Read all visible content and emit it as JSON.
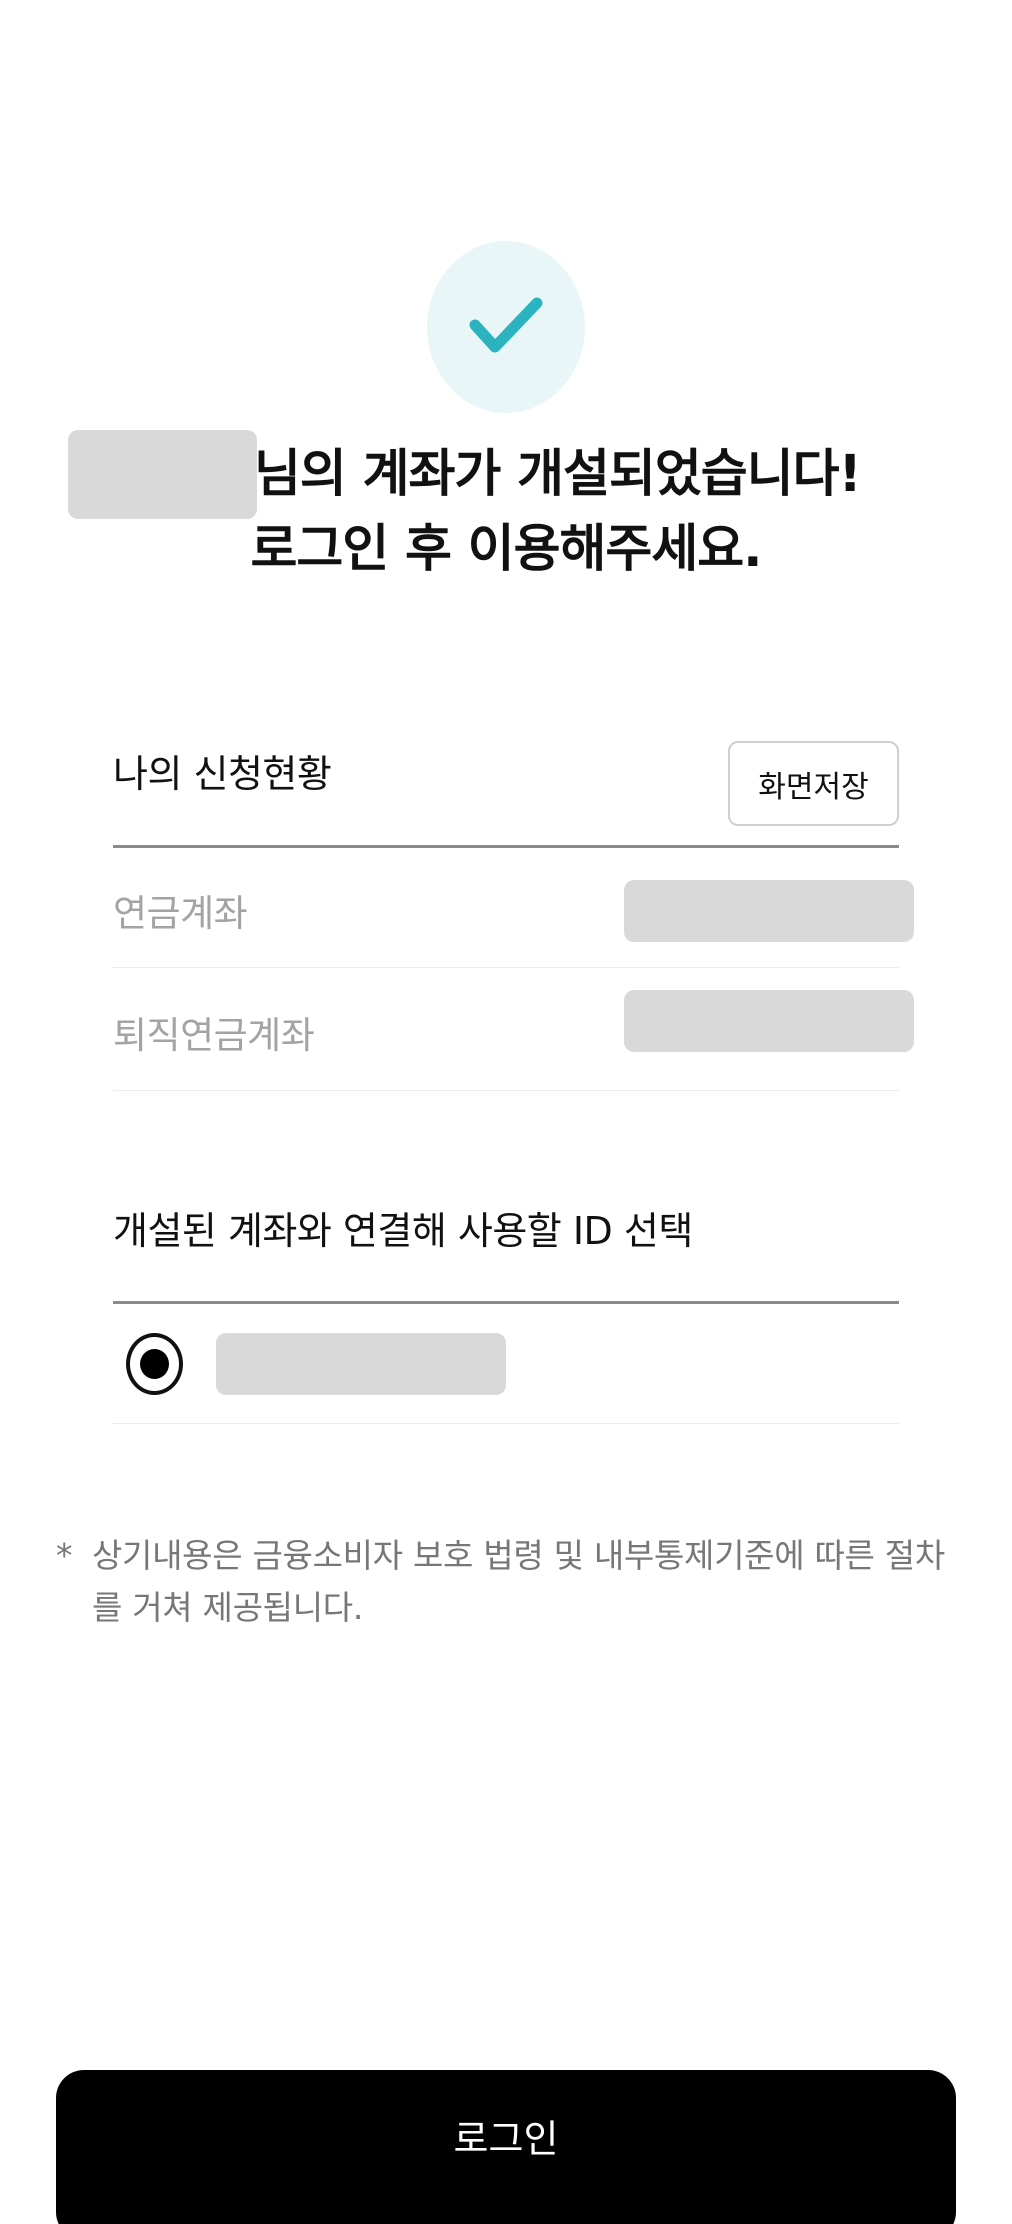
{
  "header": {
    "headline_line1": "님의 계좌가 개설되었습니다!",
    "headline_line2": "로그인 후 이용해주세요."
  },
  "application_status": {
    "title": "나의 신청현황",
    "save_label": "화면저장",
    "rows": [
      {
        "label": "연금계좌"
      },
      {
        "label": "퇴직연금계좌"
      }
    ]
  },
  "id_select": {
    "title": "개설된 계좌와 연결해 사용할 ID 선택",
    "selected": true
  },
  "notice": {
    "marker": "*",
    "text": "상기내용은 금융소비자 보호 법령 및 내부통제기준에 따른 절차를 거쳐 제공됩니다."
  },
  "footer": {
    "login_label": "로그인"
  },
  "colors": {
    "accent": "#2bb3c0",
    "icon_background": "#e8f6f7",
    "primary_button": "#000000",
    "mask": "#d9d9d9"
  },
  "icons": {
    "success": "check-icon"
  }
}
